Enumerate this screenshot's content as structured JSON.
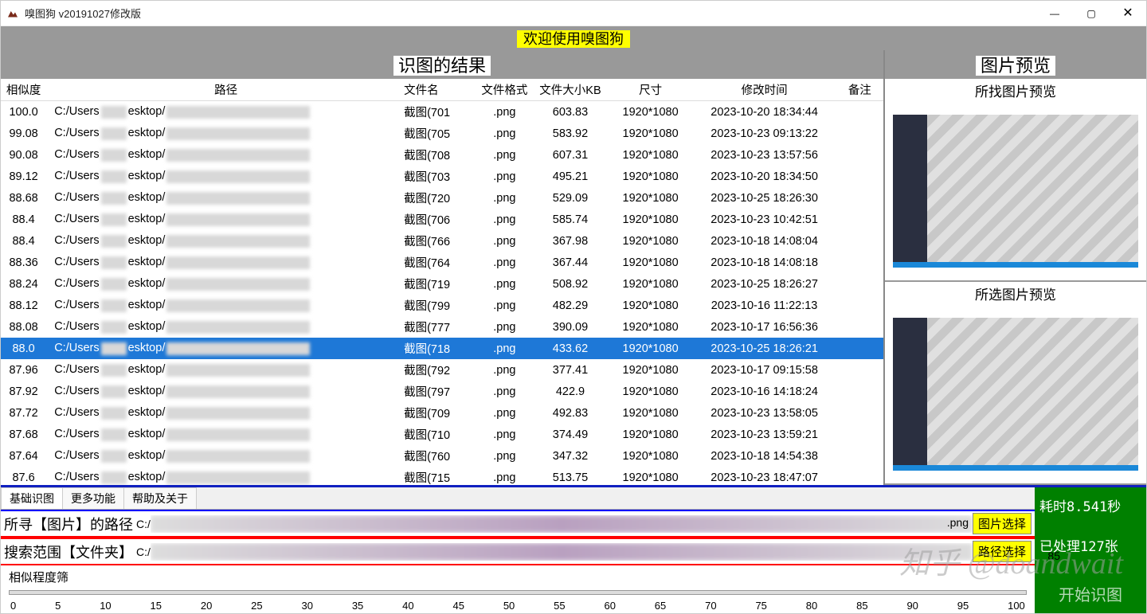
{
  "window": {
    "title": "嗅图狗 v20191027修改版"
  },
  "banner": "欢迎使用嗅图狗",
  "section_result": "识图的结果",
  "section_preview": "图片预览",
  "preview_find_label": "所找图片预览",
  "preview_sel_label": "所选图片预览",
  "columns": {
    "sim": "相似度",
    "path": "路径",
    "name": "文件名",
    "fmt": "文件格式",
    "size": "文件大小KB",
    "dim": "尺寸",
    "time": "修改时间",
    "note": "备注"
  },
  "path_prefix": "C:/Users",
  "path_mid": "esktop/",
  "name_prefix": "截图(7",
  "selected_index": 11,
  "rows": [
    {
      "sim": "100.0",
      "name_num": "01",
      "fmt": ".png",
      "size": "603.83",
      "dim": "1920*1080",
      "time": "2023-10-20 18:34:44"
    },
    {
      "sim": "99.08",
      "name_num": "05",
      "fmt": ".png",
      "size": "583.92",
      "dim": "1920*1080",
      "time": "2023-10-23 09:13:22"
    },
    {
      "sim": "90.08",
      "name_num": "08",
      "fmt": ".png",
      "size": "607.31",
      "dim": "1920*1080",
      "time": "2023-10-23 13:57:56"
    },
    {
      "sim": "89.12",
      "name_num": "03",
      "fmt": ".png",
      "size": "495.21",
      "dim": "1920*1080",
      "time": "2023-10-20 18:34:50"
    },
    {
      "sim": "88.68",
      "name_num": "20",
      "fmt": ".png",
      "size": "529.09",
      "dim": "1920*1080",
      "time": "2023-10-25 18:26:30"
    },
    {
      "sim": "88.4",
      "name_num": "06",
      "fmt": ".png",
      "size": "585.74",
      "dim": "1920*1080",
      "time": "2023-10-23 10:42:51"
    },
    {
      "sim": "88.4",
      "name_num": "66",
      "fmt": ".png",
      "size": "367.98",
      "dim": "1920*1080",
      "time": "2023-10-18 14:08:04"
    },
    {
      "sim": "88.36",
      "name_num": "64",
      "fmt": ".png",
      "size": "367.44",
      "dim": "1920*1080",
      "time": "2023-10-18 14:08:18"
    },
    {
      "sim": "88.24",
      "name_num": "19",
      "fmt": ".png",
      "size": "508.92",
      "dim": "1920*1080",
      "time": "2023-10-25 18:26:27"
    },
    {
      "sim": "88.12",
      "name_num": "99",
      "fmt": ".png",
      "size": "482.29",
      "dim": "1920*1080",
      "time": "2023-10-16 11:22:13"
    },
    {
      "sim": "88.08",
      "name_num": "77",
      "fmt": ".png",
      "size": "390.09",
      "dim": "1920*1080",
      "time": "2023-10-17 16:56:36"
    },
    {
      "sim": "88.0",
      "name_num": "18",
      "fmt": ".png",
      "size": "433.62",
      "dim": "1920*1080",
      "time": "2023-10-25 18:26:21"
    },
    {
      "sim": "87.96",
      "name_num": "92",
      "fmt": ".png",
      "size": "377.41",
      "dim": "1920*1080",
      "time": "2023-10-17 09:15:58"
    },
    {
      "sim": "87.92",
      "name_num": "97",
      "fmt": ".png",
      "size": "422.9",
      "dim": "1920*1080",
      "time": "2023-10-16 14:18:24"
    },
    {
      "sim": "87.72",
      "name_num": "09",
      "fmt": ".png",
      "size": "492.83",
      "dim": "1920*1080",
      "time": "2023-10-23 13:58:05"
    },
    {
      "sim": "87.68",
      "name_num": "10",
      "fmt": ".png",
      "size": "374.49",
      "dim": "1920*1080",
      "time": "2023-10-23 13:59:21"
    },
    {
      "sim": "87.64",
      "name_num": "60",
      "fmt": ".png",
      "size": "347.32",
      "dim": "1920*1080",
      "time": "2023-10-18 14:54:38"
    },
    {
      "sim": "87.6",
      "name_num": "15",
      "fmt": ".png",
      "size": "513.75",
      "dim": "1920*1080",
      "time": "2023-10-23 18:47:07"
    }
  ],
  "tabs": {
    "basic": "基础识图",
    "more": "更多功能",
    "help": "帮助及关于"
  },
  "find": {
    "label": "所寻【图片】的路径",
    "prefix": "C:/",
    "ext": ".png",
    "btn": "图片选择"
  },
  "scope": {
    "label": "搜索范围【文件夹】",
    "prefix": "C:/",
    "btn": "路径选择"
  },
  "slider": {
    "label": "相似程度筛",
    "value": "85",
    "ticks": [
      "0",
      "5",
      "10",
      "15",
      "20",
      "25",
      "30",
      "35",
      "40",
      "45",
      "50",
      "55",
      "60",
      "65",
      "70",
      "75",
      "80",
      "85",
      "90",
      "95",
      "100"
    ]
  },
  "status": {
    "time": "耗时8.541秒",
    "count": "已处理127张",
    "action": "开始识图"
  },
  "watermark": "知乎 @doandwait"
}
